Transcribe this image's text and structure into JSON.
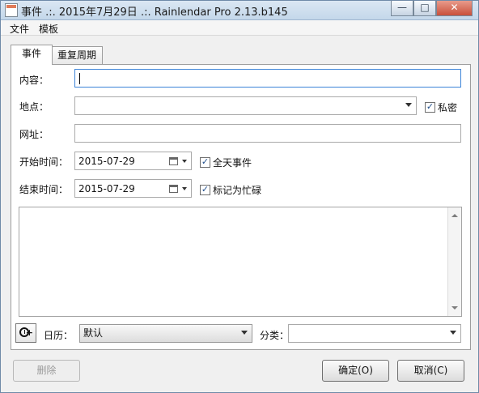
{
  "window": {
    "title": "事件 .:. 2015年7月29日 .:. Rainlendar Pro 2.13.b145",
    "controls": [
      "—",
      "□",
      "✕"
    ]
  },
  "menu": [
    "文件",
    "模板"
  ],
  "tabs": [
    "事件",
    "重复周期"
  ],
  "form": {
    "content_label": "内容：",
    "location_label": "地点：",
    "url_label": "网址：",
    "start_time_label": "开始时间：",
    "end_time_label": "结束时间：",
    "private_label": "私密",
    "all_day_label": "全天事件",
    "busy_label": "标记为忙碌",
    "start_date": "2015-07-29",
    "end_date": "2015-07-29",
    "check_mark": "✓",
    "calendar_label": "日历：",
    "calendar_value": "默认",
    "category_label": "分类：",
    "category_value": ""
  },
  "buttons": {
    "delete": "删除",
    "ok": "确定(O)",
    "cancel": "取消(C)",
    "alarm_plus": "+"
  },
  "icons": [
    "app-icon",
    "calendar-icon",
    "alarm-clock-icon",
    "chevron-down-icon",
    "checkbox-checked-icon"
  ]
}
